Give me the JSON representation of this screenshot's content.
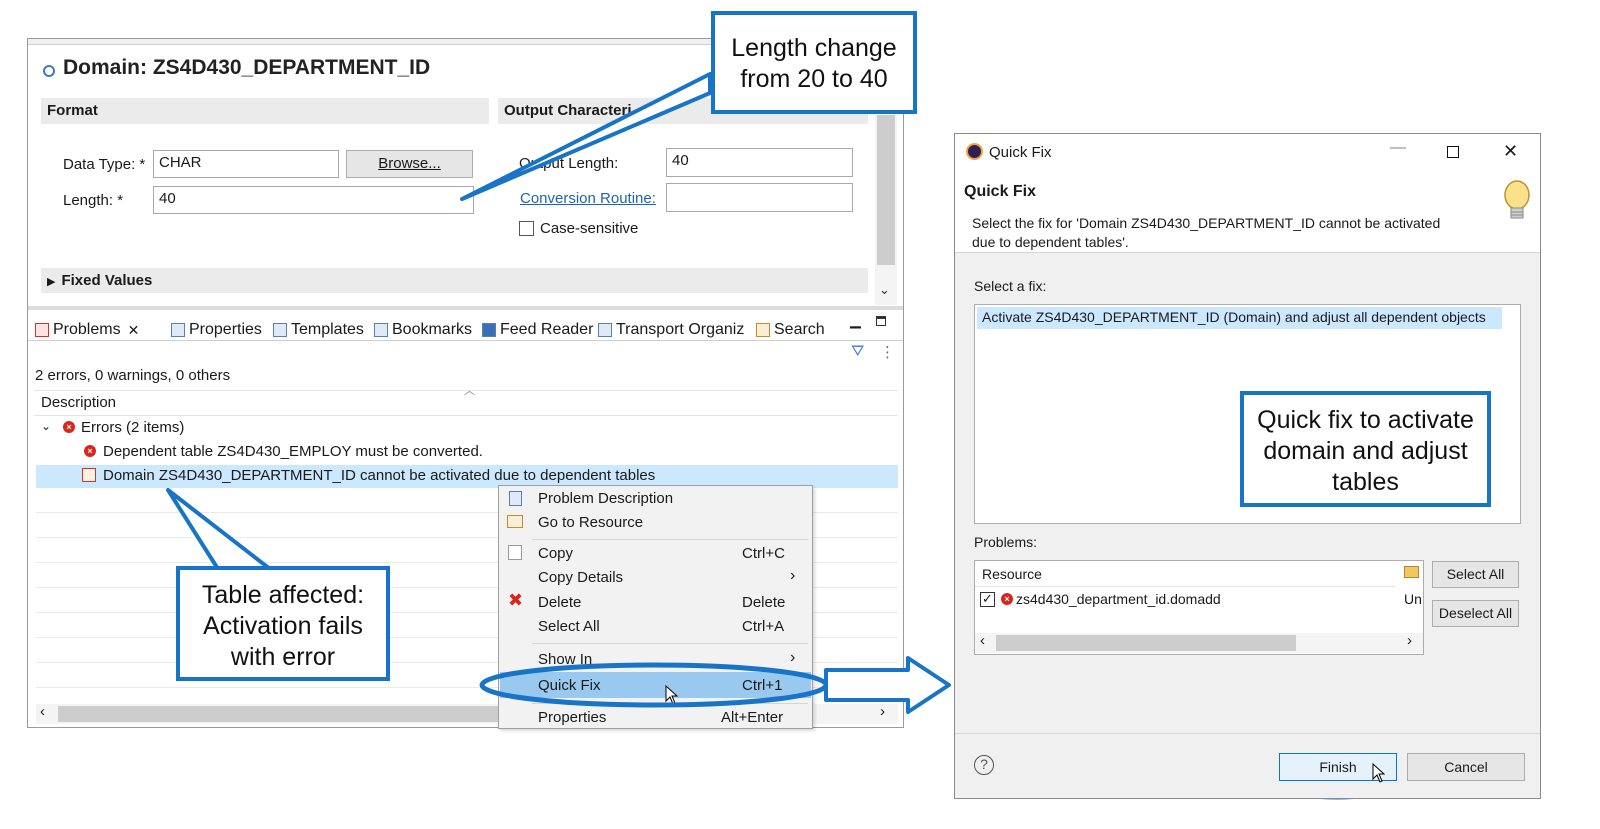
{
  "editor": {
    "title": "Domain: ZS4D430_DEPARTMENT_ID",
    "format_section": "Format",
    "output_section": "Output Characteri",
    "data_type_label": "Data Type: *",
    "data_type_value": "CHAR",
    "browse_label": "Browse...",
    "length_label": "Length: *",
    "length_value": "40",
    "output_length_label": "Output Length:",
    "output_length_value": "40",
    "conversion_routine_label": "Conversion Routine:",
    "case_sensitive_label": "Case-sensitive",
    "fixed_values_label": "Fixed Values"
  },
  "tabs": [
    "Problems",
    "Properties",
    "Templates",
    "Bookmarks",
    "Feed Reader",
    "Transport Organiz",
    "Search"
  ],
  "problems": {
    "summary": "2 errors, 0 warnings, 0 others",
    "column_header": "Description",
    "group_label": "Errors (2 items)",
    "items": [
      "Dependent table ZS4D430_EMPLOY must be converted.",
      "Domain ZS4D430_DEPARTMENT_ID cannot be activated due to dependent tables"
    ]
  },
  "context_menu": {
    "items": [
      {
        "label": "Problem Description",
        "shortcut": ""
      },
      {
        "label": "Go to Resource",
        "shortcut": ""
      },
      {
        "label": "Copy",
        "shortcut": "Ctrl+C"
      },
      {
        "label": "Copy Details",
        "shortcut": "›"
      },
      {
        "label": "Delete",
        "shortcut": "Delete"
      },
      {
        "label": "Select All",
        "shortcut": "Ctrl+A"
      },
      {
        "label": "Show In",
        "shortcut": "›"
      },
      {
        "label": "Quick Fix",
        "shortcut": "Ctrl+1"
      },
      {
        "label": "Properties",
        "shortcut": "Alt+Enter"
      }
    ]
  },
  "callouts": {
    "length_change": "Length change from 20 to 40",
    "table_affected": "Table affected: Activation fails with error",
    "quick_fix_note": "Quick fix to activate domain and adjust tables"
  },
  "dialog": {
    "window_title": "Quick Fix",
    "heading": "Quick Fix",
    "description": "Select the fix for 'Domain ZS4D430_DEPARTMENT_ID cannot be activated due to dependent tables'.",
    "select_fix_label": "Select a fix:",
    "fix_option": "Activate ZS4D430_DEPARTMENT_ID (Domain) and adjust all dependent objects",
    "problems_label": "Problems:",
    "resource_header": "Resource",
    "resource_item": "zs4d430_department_id.domadd",
    "resource_extra": "Un",
    "select_all": "Select All",
    "deselect_all": "Deselect All",
    "finish": "Finish",
    "cancel": "Cancel",
    "help": "?"
  },
  "colors": {
    "callout_border": "#1874c6",
    "selection": "#cce8ff",
    "menu_highlight": "#99c9ef"
  }
}
